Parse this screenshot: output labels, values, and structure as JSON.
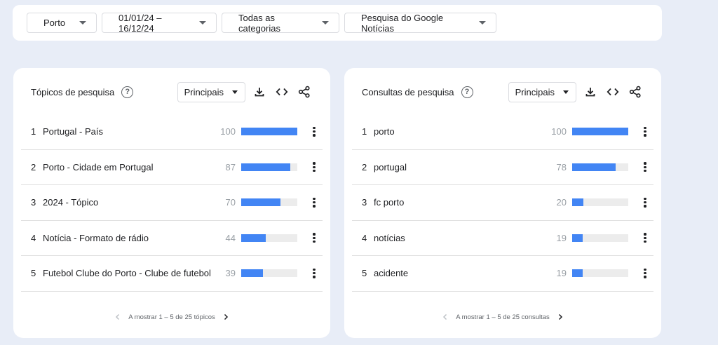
{
  "filters": {
    "location": "Porto",
    "date_range": "01/01/24 – 16/12/24",
    "category": "Todas as categorias",
    "search_type": "Pesquisa do Google Notícias"
  },
  "topics": {
    "title": "Tópicos de pesquisa",
    "sort_label": "Principais",
    "rows": [
      {
        "rank": "1",
        "label": "Portugal - País",
        "value": "100",
        "pct": 100
      },
      {
        "rank": "2",
        "label": "Porto - Cidade em Portugal",
        "value": "87",
        "pct": 87
      },
      {
        "rank": "3",
        "label": "2024 - Tópico",
        "value": "70",
        "pct": 70
      },
      {
        "rank": "4",
        "label": "Notícia - Formato de rádio",
        "value": "44",
        "pct": 44
      },
      {
        "rank": "5",
        "label": "Futebol Clube do Porto - Clube de futebol",
        "value": "39",
        "pct": 39
      }
    ],
    "pager_text": "A mostrar 1 – 5 de 25 tópicos"
  },
  "queries": {
    "title": "Consultas de pesquisa",
    "sort_label": "Principais",
    "rows": [
      {
        "rank": "1",
        "label": "porto",
        "value": "100",
        "pct": 100
      },
      {
        "rank": "2",
        "label": "portugal",
        "value": "78",
        "pct": 78
      },
      {
        "rank": "3",
        "label": "fc porto",
        "value": "20",
        "pct": 20
      },
      {
        "rank": "4",
        "label": "notícias",
        "value": "19",
        "pct": 19
      },
      {
        "rank": "5",
        "label": "acidente",
        "value": "19",
        "pct": 19
      }
    ],
    "pager_text": "A mostrar 1 – 5 de 25 consultas"
  },
  "colors": {
    "bar": "#4285f4",
    "track": "#ececec",
    "background": "#e8edf7"
  },
  "icons": [
    "help-icon",
    "download-icon",
    "embed-code-icon",
    "share-icon",
    "more-vert-icon",
    "chevron-left-icon",
    "chevron-right-icon"
  ]
}
